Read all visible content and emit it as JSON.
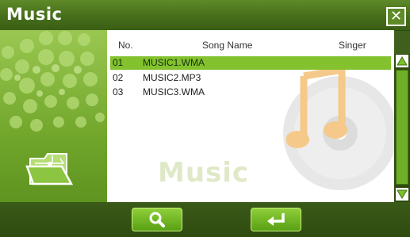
{
  "window": {
    "title": "Music",
    "close_glyph": "✕"
  },
  "table": {
    "headers": {
      "no": "No.",
      "name": "Song Name",
      "singer": "Singer"
    },
    "rows": [
      {
        "no": "01",
        "name": "MUSIC1.WMA",
        "singer": "",
        "selected": true
      },
      {
        "no": "02",
        "name": "MUSIC2.MP3",
        "singer": "",
        "selected": false
      },
      {
        "no": "03",
        "name": "MUSIC3.WMA",
        "singer": "",
        "selected": false
      }
    ]
  },
  "watermark": {
    "text": "Music"
  },
  "icons": {
    "folder": "folder-icon",
    "music_note": "music-note-icon",
    "cd": "cd-icon",
    "search": "search-icon",
    "enter": "enter-icon",
    "scroll_up": "scroll-up-icon",
    "scroll_down": "scroll-down-icon"
  },
  "colors": {
    "accent": "#83c22e",
    "title_bg": "#466e1a",
    "bar_bg": "#3a5a18",
    "panel_green": "#7ab232"
  }
}
